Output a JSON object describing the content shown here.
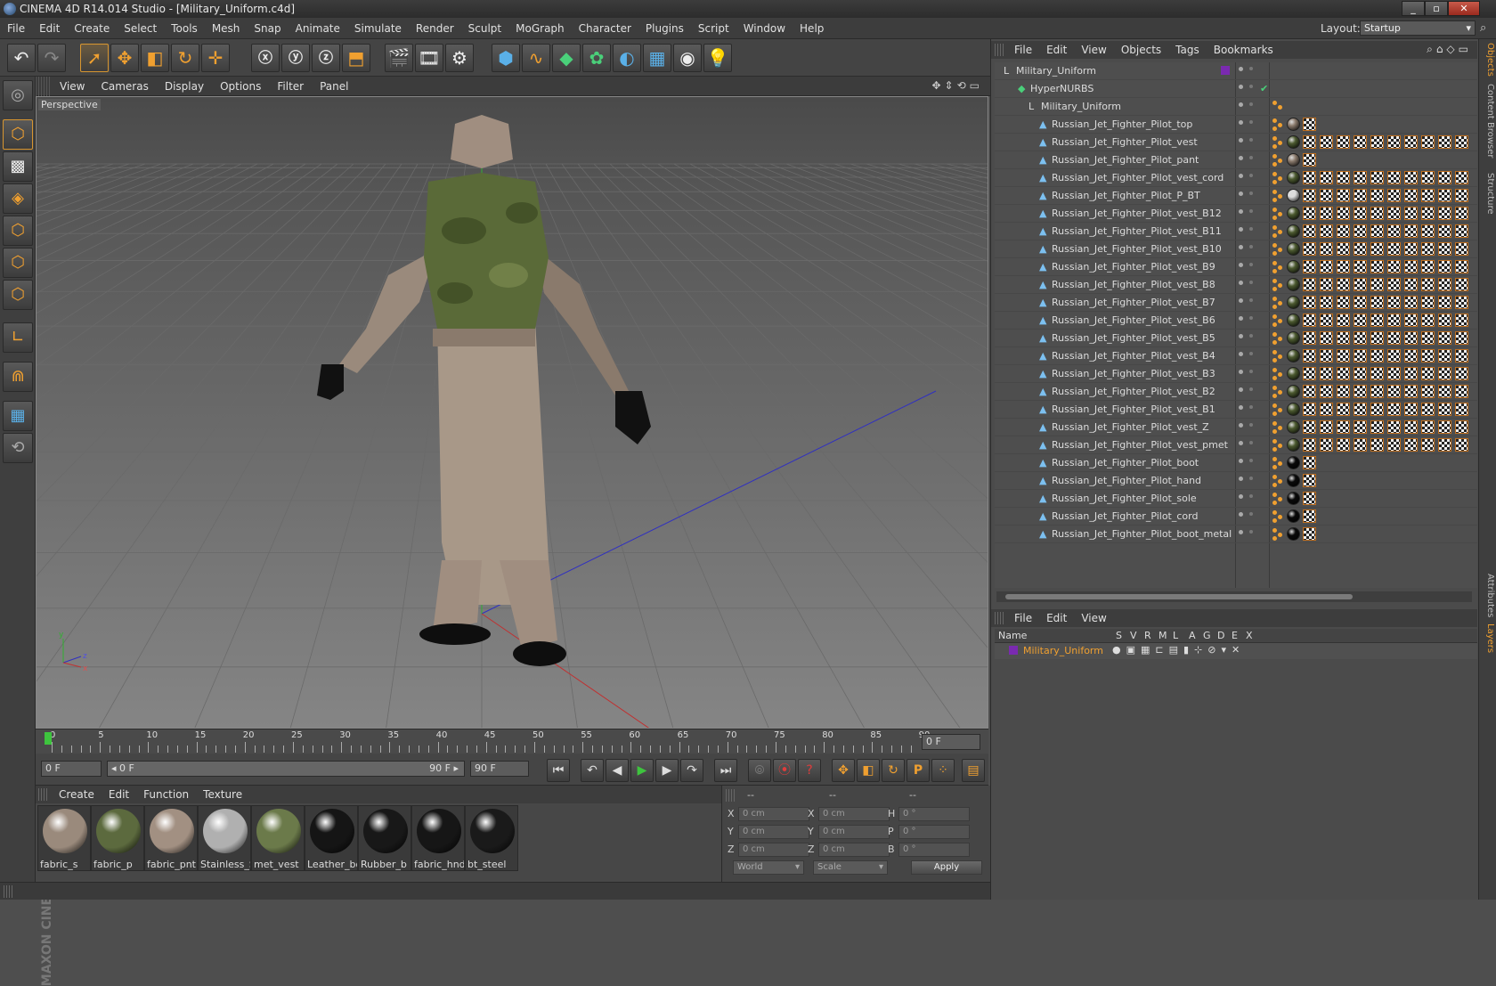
{
  "window": {
    "title": "CINEMA 4D R14.014 Studio - [Military_Uniform.c4d]"
  },
  "menubar": {
    "items": [
      "File",
      "Edit",
      "Create",
      "Select",
      "Tools",
      "Mesh",
      "Snap",
      "Animate",
      "Simulate",
      "Render",
      "Sculpt",
      "MoGraph",
      "Character",
      "Plugins",
      "Script",
      "Window",
      "Help"
    ],
    "layout_label": "Layout:",
    "layout_value": "Startup"
  },
  "viewport": {
    "menu": [
      "View",
      "Cameras",
      "Display",
      "Options",
      "Filter",
      "Panel"
    ],
    "label": "Perspective",
    "axis_labels": {
      "y": "y",
      "z": "z",
      "x": "x"
    }
  },
  "timeline": {
    "ticks": [
      "0",
      "5",
      "10",
      "15",
      "20",
      "25",
      "30",
      "35",
      "40",
      "45",
      "50",
      "55",
      "60",
      "65",
      "70",
      "75",
      "80",
      "85",
      "90"
    ],
    "current_frame": "0 F"
  },
  "playback": {
    "start_frame": "0 F",
    "range_start": "◂ 0 F",
    "range_end": "90 F ▸",
    "end_frame": "90 F"
  },
  "materials": {
    "menu": [
      "Create",
      "Edit",
      "Function",
      "Texture"
    ],
    "items": [
      {
        "name": "fabric_s",
        "color": "#9a8a7c"
      },
      {
        "name": "fabric_p",
        "color": "#5c6a3e"
      },
      {
        "name": "fabric_pnt",
        "color": "#a29082"
      },
      {
        "name": "Stainless_S",
        "color": "#b0b0b0"
      },
      {
        "name": "met_vest",
        "color": "#6b7a4a"
      },
      {
        "name": "Leather_bo",
        "color": "#151515"
      },
      {
        "name": "Rubber_b",
        "color": "#181818"
      },
      {
        "name": "fabric_hnd",
        "color": "#161616"
      },
      {
        "name": "bt_steel",
        "color": "#1a1a1a"
      }
    ]
  },
  "coordinates": {
    "headers": [
      "--",
      "--",
      "--"
    ],
    "rows": [
      {
        "a": "X",
        "av": "0 cm",
        "b": "X",
        "bv": "0 cm",
        "c": "H",
        "cv": "0 °"
      },
      {
        "a": "Y",
        "av": "0 cm",
        "b": "Y",
        "bv": "0 cm",
        "c": "P",
        "cv": "0 °"
      },
      {
        "a": "Z",
        "av": "0 cm",
        "b": "Z",
        "bv": "0 cm",
        "c": "B",
        "cv": "0 °"
      }
    ],
    "mode1": "World",
    "mode2": "Scale",
    "apply": "Apply"
  },
  "object_manager": {
    "menu": [
      "File",
      "Edit",
      "View",
      "Objects",
      "Tags",
      "Bookmarks"
    ],
    "root": "Military_Uniform",
    "hypernurbs": "HyperNURBS",
    "group": "Military_Uniform",
    "objects": [
      {
        "name": "Russian_Jet_Fighter_Pilot_top",
        "mat": "#8a7a6c",
        "tex": 1
      },
      {
        "name": "Russian_Jet_Fighter_Pilot_vest",
        "mat": "#4c5a30",
        "tex": 10
      },
      {
        "name": "Russian_Jet_Fighter_Pilot_pant",
        "mat": "#8a7a6c",
        "tex": 1
      },
      {
        "name": "Russian_Jet_Fighter_Pilot_vest_cord",
        "mat": "#4c5a30",
        "tex": 10
      },
      {
        "name": "Russian_Jet_Fighter_Pilot_P_BT",
        "mat": "#dddddd",
        "tex": 10
      },
      {
        "name": "Russian_Jet_Fighter_Pilot_vest_B12",
        "mat": "#4c5a30",
        "tex": 10
      },
      {
        "name": "Russian_Jet_Fighter_Pilot_vest_B11",
        "mat": "#4c5a30",
        "tex": 10
      },
      {
        "name": "Russian_Jet_Fighter_Pilot_vest_B10",
        "mat": "#4c5a30",
        "tex": 10
      },
      {
        "name": "Russian_Jet_Fighter_Pilot_vest_B9",
        "mat": "#4c5a30",
        "tex": 10
      },
      {
        "name": "Russian_Jet_Fighter_Pilot_vest_B8",
        "mat": "#4c5a30",
        "tex": 10
      },
      {
        "name": "Russian_Jet_Fighter_Pilot_vest_B7",
        "mat": "#4c5a30",
        "tex": 10
      },
      {
        "name": "Russian_Jet_Fighter_Pilot_vest_B6",
        "mat": "#4c5a30",
        "tex": 10
      },
      {
        "name": "Russian_Jet_Fighter_Pilot_vest_B5",
        "mat": "#4c5a30",
        "tex": 10
      },
      {
        "name": "Russian_Jet_Fighter_Pilot_vest_B4",
        "mat": "#4c5a30",
        "tex": 10
      },
      {
        "name": "Russian_Jet_Fighter_Pilot_vest_B3",
        "mat": "#4c5a30",
        "tex": 10
      },
      {
        "name": "Russian_Jet_Fighter_Pilot_vest_B2",
        "mat": "#4c5a30",
        "tex": 10
      },
      {
        "name": "Russian_Jet_Fighter_Pilot_vest_B1",
        "mat": "#4c5a30",
        "tex": 10
      },
      {
        "name": "Russian_Jet_Fighter_Pilot_vest_Z",
        "mat": "#4c5a30",
        "tex": 10
      },
      {
        "name": "Russian_Jet_Fighter_Pilot_vest_pmet",
        "mat": "#4c5a30",
        "tex": 10
      },
      {
        "name": "Russian_Jet_Fighter_Pilot_boot",
        "mat": "#0a0a0a",
        "tex": 1
      },
      {
        "name": "Russian_Jet_Fighter_Pilot_hand",
        "mat": "#0a0a0a",
        "tex": 1
      },
      {
        "name": "Russian_Jet_Fighter_Pilot_sole",
        "mat": "#0a0a0a",
        "tex": 1
      },
      {
        "name": "Russian_Jet_Fighter_Pilot_cord",
        "mat": "#0a0a0a",
        "tex": 1
      },
      {
        "name": "Russian_Jet_Fighter_Pilot_boot_metal",
        "mat": "#0a0a0a",
        "tex": 1
      }
    ]
  },
  "layer_manager": {
    "menu": [
      "File",
      "Edit",
      "View"
    ],
    "columns": [
      "Name",
      "S",
      "V",
      "R",
      "M",
      "L",
      "A",
      "G",
      "D",
      "E",
      "X"
    ],
    "layer": {
      "name": "Military_Uniform",
      "color": "#7a2ab0"
    }
  },
  "side_tabs": [
    "Objects",
    "Content Browser",
    "Structure",
    "Attributes",
    "Layers"
  ],
  "colors": {
    "accent": "#f0a030",
    "selected_text": "#f0a030",
    "grid_blue": "#3030c0",
    "grid_red": "#c03030",
    "grid_green": "#30b030"
  }
}
